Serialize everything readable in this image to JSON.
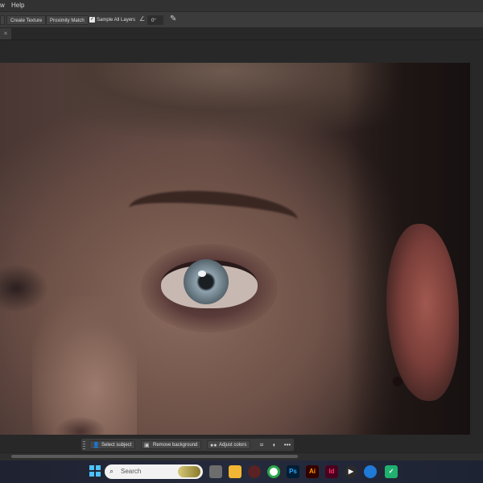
{
  "menu": {
    "items": [
      "w",
      "Help"
    ]
  },
  "options_bar": {
    "create_texture": "Create Texture",
    "proximity_match": "Proximity Match",
    "sample_all_layers": "Sample All Layers",
    "angle_value": "0°"
  },
  "context_bar": {
    "select_subject": "Select subject",
    "remove_background": "Remove background",
    "adjust_colors": "Adjust colors"
  },
  "taskbar": {
    "search_placeholder": "Search",
    "apps": [
      "Ps",
      "Ai",
      "Id"
    ]
  },
  "icons": {
    "checkbox": "checkbox-checked-icon",
    "angle": "angle-icon",
    "pressure": "pen-pressure-icon",
    "tab_close": "close-icon"
  }
}
